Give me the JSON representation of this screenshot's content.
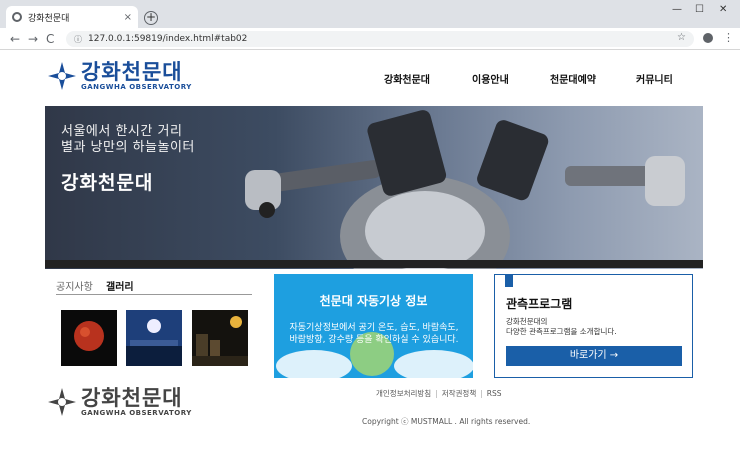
{
  "browser": {
    "tab_title": "강화천문대",
    "tab_close": "×",
    "new_tab": "+",
    "url": "127.0.0.1:59819/index.html#tab02",
    "win_minimize": "—",
    "win_maximize": "☐",
    "win_close": "✕",
    "back": "←",
    "forward": "→",
    "reload": "C",
    "star": "☆",
    "menu": "⋮"
  },
  "site": {
    "logo_ko": "강화천문대",
    "logo_en": "GANGWHA OBSERVATORY",
    "nav": [
      "강화천문대",
      "이용안내",
      "천문대예약",
      "커뮤니티"
    ]
  },
  "hero": {
    "line1": "서울에서 한시간 거리",
    "line2": "별과 낭만의 하늘놀이터",
    "title": "강화천문대"
  },
  "board": {
    "tab_notice": "공지사항",
    "tab_gallery": "갤러리"
  },
  "weather": {
    "title": "천문대 자동기상 정보",
    "desc": "자동기상정보에서 공기 온도, 습도, 바람속도, 바람방향, 강수량 등을 확인하실 수 있습니다."
  },
  "program": {
    "title": "관측프로그램",
    "desc_line1": "강화천문대의",
    "desc_line2": "다양한 관측프로그램을 소개합니다.",
    "button": "바로가기 →"
  },
  "footer": {
    "logo_ko": "강화천문대",
    "logo_en": "GANGWHA OBSERVATORY",
    "links": [
      "개인정보처리방침",
      "저작권정책",
      "RSS"
    ],
    "copyright": "Copyright ⓒ MUSTMALL . All rights reserved."
  },
  "colors": {
    "brand": "#1a4e9a",
    "weather_bg": "#1e9fe0",
    "program_blue": "#1a5fa8"
  }
}
